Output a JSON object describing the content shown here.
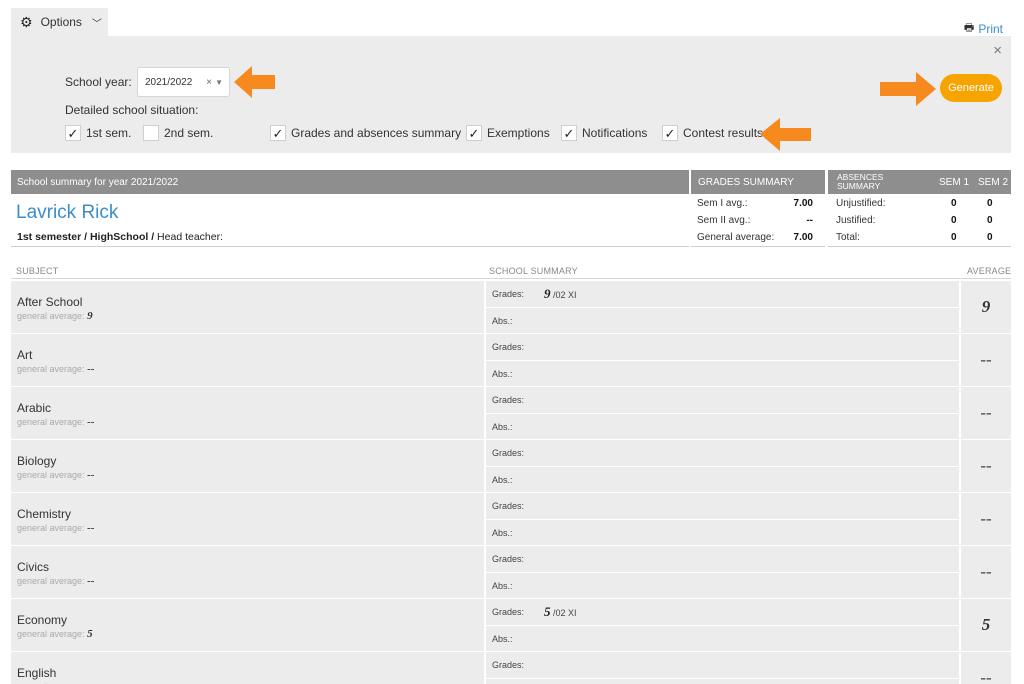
{
  "options": {
    "label": "Options",
    "gear_icon": "gear-icon",
    "chevron_icon": "chevron-down-icon"
  },
  "print": {
    "label": "Print",
    "icon": "printer-icon"
  },
  "panel": {
    "school_year_label": "School year:",
    "school_year_value": "2021/2022",
    "clear_glyph": "×",
    "dropdown_glyph": "▼",
    "detail_label": "Detailed school situation:",
    "checkboxes": [
      {
        "label": "1st sem.",
        "checked": true
      },
      {
        "label": "2nd sem.",
        "checked": false
      },
      {
        "label": "Grades and absences summary",
        "checked": true
      },
      {
        "label": "Exemptions",
        "checked": true
      },
      {
        "label": "Notifications",
        "checked": true
      },
      {
        "label": "Contest results",
        "checked": true
      }
    ],
    "generate_label": "Generate",
    "close_glyph": "×"
  },
  "summary": {
    "title": "School summary for year 2021/2022",
    "student_name": "Lavrick Rick",
    "info_bold": "1st semester / HighSchool /",
    "info_rest": " Head teacher:",
    "grades_summary_title": "GRADES SUMMARY",
    "grades": [
      {
        "label": "Sem I avg.:",
        "value": "7.00"
      },
      {
        "label": "Sem II avg.:",
        "value": "--"
      },
      {
        "label": "General average:",
        "value": "7.00"
      }
    ],
    "absences_title_1": "ABSENCES",
    "absences_title_2": "SUMMARY",
    "sem1_label": "SEM 1",
    "sem2_label": "SEM 2",
    "absences": [
      {
        "label": "Unjustified:",
        "sem1": "0",
        "sem2": "0"
      },
      {
        "label": "Justified:",
        "sem1": "0",
        "sem2": "0"
      },
      {
        "label": "Total:",
        "sem1": "0",
        "sem2": "0"
      }
    ]
  },
  "table": {
    "headers": {
      "subject": "SUBJECT",
      "school_summary": "SCHOOL SUMMARY",
      "average": "AVERAGE"
    },
    "grades_label": "Grades:",
    "abs_label": "Abs.:",
    "gavg_label": "general average: ",
    "rows": [
      {
        "subject": "After School",
        "gavg": "9",
        "grade": "9",
        "grade_date": " /02 XI",
        "average": "9"
      },
      {
        "subject": "Art",
        "gavg": "--",
        "grade": "",
        "grade_date": "",
        "average": "--"
      },
      {
        "subject": "Arabic",
        "gavg": "--",
        "grade": "",
        "grade_date": "",
        "average": "--"
      },
      {
        "subject": "Biology",
        "gavg": "--",
        "grade": "",
        "grade_date": "",
        "average": "--"
      },
      {
        "subject": "Chemistry",
        "gavg": "--",
        "grade": "",
        "grade_date": "",
        "average": "--"
      },
      {
        "subject": "Civics",
        "gavg": "--",
        "grade": "",
        "grade_date": "",
        "average": "--"
      },
      {
        "subject": "Economy",
        "gavg": "5",
        "grade": "5",
        "grade_date": " /02 XI",
        "average": "5"
      },
      {
        "subject": "English",
        "gavg": "--",
        "grade": "",
        "grade_date": "",
        "average": "--"
      }
    ]
  },
  "colors": {
    "accent": "#3a8ec9",
    "generate": "#f7a400",
    "arrow": "#f68a1f",
    "header_bar": "#8e8e8e",
    "panel_bg": "#ececec"
  }
}
